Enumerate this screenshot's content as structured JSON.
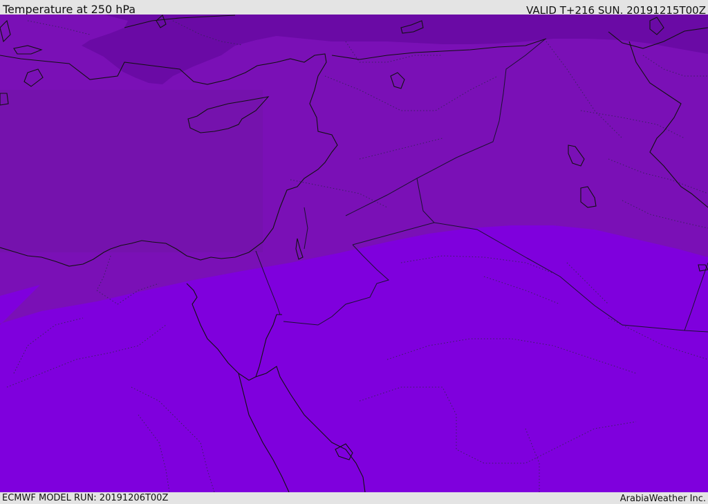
{
  "header": {
    "title": "Temperature at 250 hPa",
    "valid_time": "VALID T+216 SUN. 20191215T00Z"
  },
  "footer": {
    "model_run": "ECMWF MODEL RUN: 20191206T00Z",
    "provider": "ArabiaWeather Inc."
  },
  "map": {
    "colors": {
      "cold_band": "#6a0aa5",
      "mid_band": "#7a10b6",
      "mid_band_west": "#7512ad",
      "warm_band": "#7f00dd",
      "coastline": "#111111",
      "border": "#1b1030",
      "internal_border": "#3a2060"
    }
  }
}
